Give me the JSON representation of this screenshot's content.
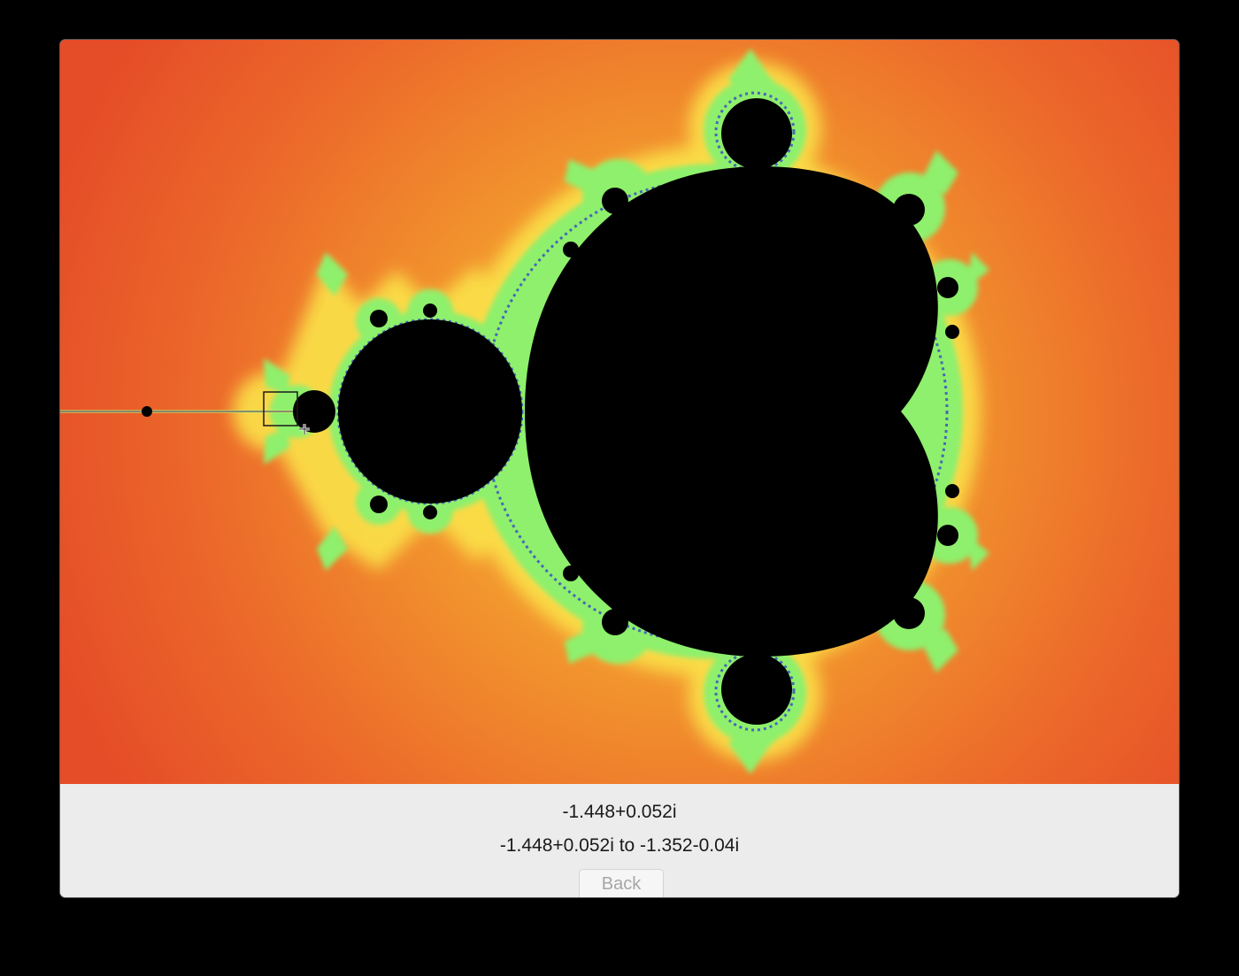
{
  "viewer": {
    "cursor_coordinate": "-1.448+0.052i",
    "selection_range": "-1.448+0.052i to -1.352-0.04i",
    "back_label": "Back"
  },
  "colors": {
    "exterior_far": "#e8502a",
    "exterior_near": "#f5c23a",
    "boundary_glow": "#f7f25a",
    "filament_green": "#7cf56c",
    "filament_blue": "#3c52c8",
    "interior": "#000000",
    "panel_background": "#ececec"
  }
}
